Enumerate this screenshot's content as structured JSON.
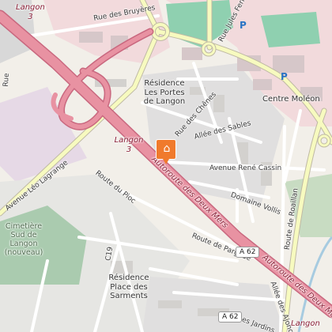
{
  "map": {
    "places": {
      "langon_top": "Langon",
      "langon_top_shield": "3",
      "residence_portes_line1": "Résidence",
      "residence_portes_line2": "Les Portes",
      "residence_portes_line3": "de Langon",
      "centre_moleon": "Centre Moléon",
      "langon_mid": "Langon",
      "langon_mid_shield": "3",
      "cemetery_line1": "Cimetière",
      "cemetery_line2": "Sud de",
      "cemetery_line3": "Langon",
      "cemetery_line4": "(nouveau)",
      "residence_sarments_line1": "Résidence",
      "residence_sarments_line2": "Place des",
      "residence_sarments_line3": "Sarments",
      "langon_bottom": "Langon"
    },
    "roads": {
      "rue_bruyeres": "Rue des Bruyères",
      "rue_jules_ferry": "Rue Jules Ferry",
      "rue_chenes": "Rue des Chênes",
      "allee_sables": "Allée des Sables",
      "avenue_rene_cassin": "Avenue René Cassin",
      "domaine_vollis": "Domaine Vollis",
      "rue_roaillan": "Route de Roaillan",
      "avenue_leo_lagrange": "Avenue Léo Lagrange",
      "route_du_pioc": "Route du Pioc",
      "autoroute_a": "Autoroute des Deux Mers",
      "autoroute_b": "Autoroute des Deux Mers",
      "route_pargade": "Route de Pargade",
      "c19": "C19",
      "rue_ajonc": "Allée des Ajoncs",
      "les_jardins": "Les Jardins",
      "rue_left": "Rue"
    },
    "shields": {
      "a62_upper": "A 62",
      "a62_lower": "A 62"
    },
    "parking_symbol": "P",
    "pin_icon": "home-icon",
    "colors": {
      "background": "#f2efe9",
      "motorway": "#e892a2",
      "motorway_casing": "#c9687f",
      "commercial": "#f2dadc",
      "sports": "#8fd0b0",
      "cemetery": "#aacbaf",
      "residential": "#e0dfdf",
      "marker": "#f07a2c",
      "secondary_road": "#f7fabf"
    }
  }
}
